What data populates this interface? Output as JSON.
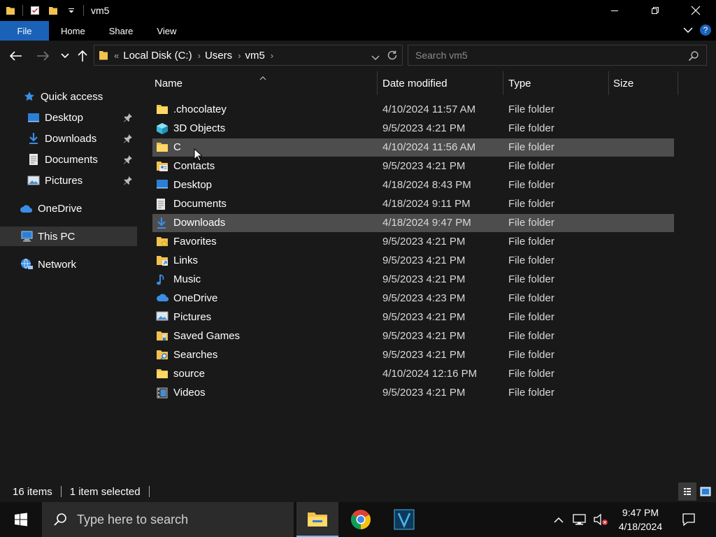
{
  "window": {
    "title": "vm5"
  },
  "ribbon": {
    "tabs": [
      "File",
      "Home",
      "Share",
      "View"
    ]
  },
  "address": {
    "overflow": "«",
    "crumbs": [
      "Local Disk (C:)",
      "Users",
      "vm5"
    ]
  },
  "search": {
    "placeholder": "Search vm5"
  },
  "navpane": {
    "items": [
      {
        "label": "Quick access",
        "icon": "star-icon",
        "pinned": false
      },
      {
        "label": "Desktop",
        "icon": "desktop-icon",
        "pinned": true
      },
      {
        "label": "Downloads",
        "icon": "download-icon",
        "pinned": true
      },
      {
        "label": "Documents",
        "icon": "documents-icon",
        "pinned": true
      },
      {
        "label": "Pictures",
        "icon": "pictures-icon",
        "pinned": true
      },
      {
        "label": "OneDrive",
        "icon": "cloud-icon",
        "pinned": false
      },
      {
        "label": "This PC",
        "icon": "computer-icon",
        "pinned": false,
        "selected": true
      },
      {
        "label": "Network",
        "icon": "network-icon",
        "pinned": false
      }
    ]
  },
  "columns": {
    "name": "Name",
    "date": "Date modified",
    "type": "Type",
    "size": "Size"
  },
  "files": [
    {
      "name": ".chocolatey",
      "date": "4/10/2024 11:57 AM",
      "type": "File folder",
      "icon": "folder-icon"
    },
    {
      "name": "3D Objects",
      "date": "9/5/2023 4:21 PM",
      "type": "File folder",
      "icon": "cube-icon"
    },
    {
      "name": "C",
      "date": "4/10/2024 11:56 AM",
      "type": "File folder",
      "icon": "folder-icon",
      "hover": true
    },
    {
      "name": "Contacts",
      "date": "9/5/2023 4:21 PM",
      "type": "File folder",
      "icon": "contacts-icon"
    },
    {
      "name": "Desktop",
      "date": "4/18/2024 8:43 PM",
      "type": "File folder",
      "icon": "desktop-icon"
    },
    {
      "name": "Documents",
      "date": "4/18/2024 9:11 PM",
      "type": "File folder",
      "icon": "documents-icon"
    },
    {
      "name": "Downloads",
      "date": "4/18/2024 9:47 PM",
      "type": "File folder",
      "icon": "download-icon",
      "selected": true
    },
    {
      "name": "Favorites",
      "date": "9/5/2023 4:21 PM",
      "type": "File folder",
      "icon": "favorites-icon"
    },
    {
      "name": "Links",
      "date": "9/5/2023 4:21 PM",
      "type": "File folder",
      "icon": "links-icon"
    },
    {
      "name": "Music",
      "date": "9/5/2023 4:21 PM",
      "type": "File folder",
      "icon": "music-icon"
    },
    {
      "name": "OneDrive",
      "date": "9/5/2023 4:23 PM",
      "type": "File folder",
      "icon": "cloud-icon"
    },
    {
      "name": "Pictures",
      "date": "9/5/2023 4:21 PM",
      "type": "File folder",
      "icon": "pictures-icon"
    },
    {
      "name": "Saved Games",
      "date": "9/5/2023 4:21 PM",
      "type": "File folder",
      "icon": "saved-games-icon"
    },
    {
      "name": "Searches",
      "date": "9/5/2023 4:21 PM",
      "type": "File folder",
      "icon": "searches-icon"
    },
    {
      "name": "source",
      "date": "4/10/2024 12:16 PM",
      "type": "File folder",
      "icon": "folder-icon"
    },
    {
      "name": "Videos",
      "date": "9/5/2023 4:21 PM",
      "type": "File folder",
      "icon": "videos-icon"
    }
  ],
  "status": {
    "count": "16 items",
    "selection": "1 item selected"
  },
  "taskbar": {
    "search_placeholder": "Type here to search",
    "time": "9:47 PM",
    "date": "4/18/2024"
  },
  "colors": {
    "folder": "#f2c14e",
    "accent": "#1a62b8",
    "selected_row": "#4d4d4d",
    "blue_icon": "#3a8ee6"
  }
}
